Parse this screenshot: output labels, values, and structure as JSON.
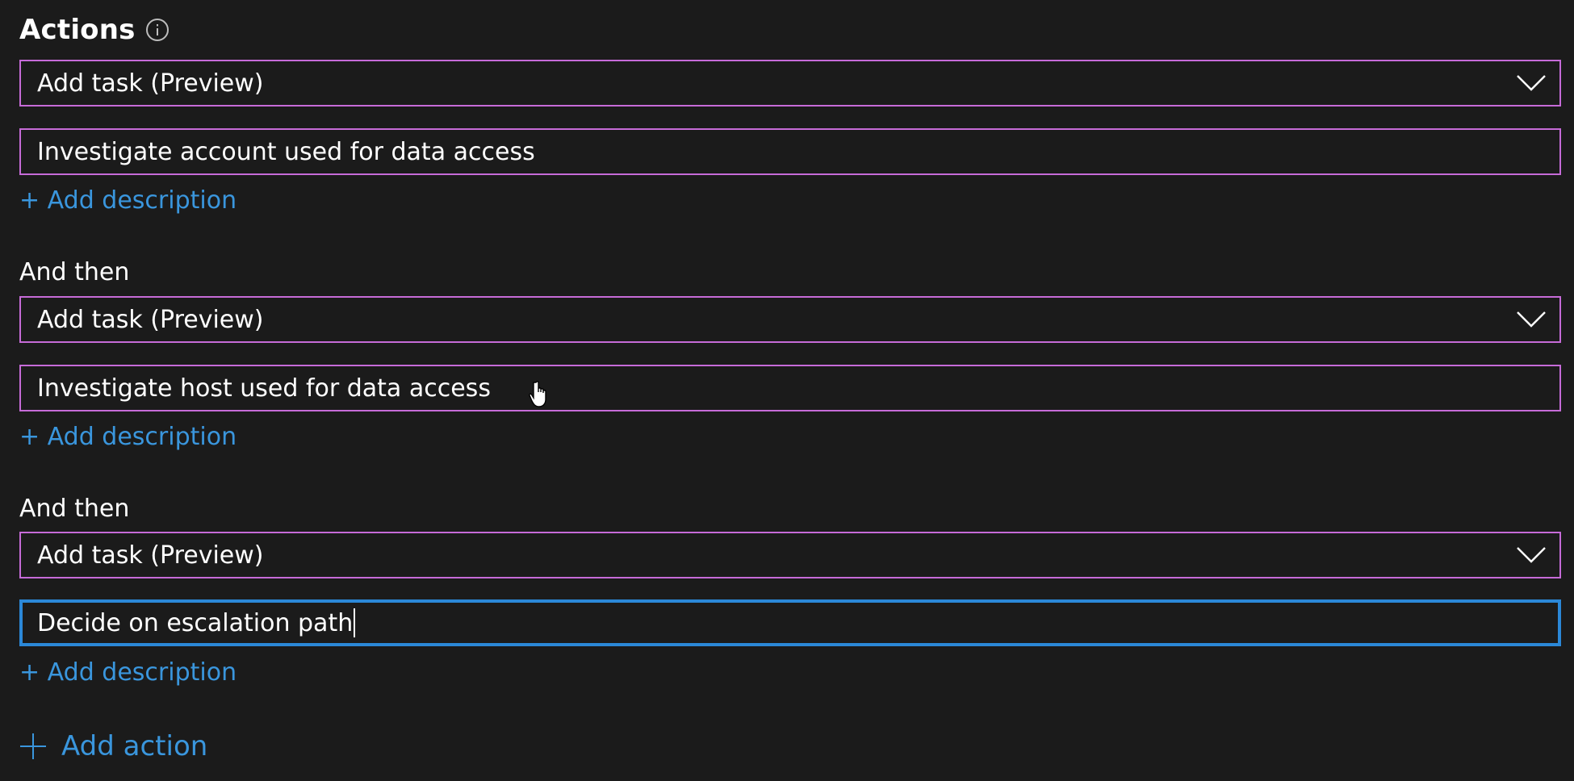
{
  "section": {
    "title": "Actions",
    "info_icon": "info-icon"
  },
  "actions": [
    {
      "type_value": "Add task (Preview)",
      "title_value": "Investigate account used for data access",
      "add_description_label": "+ Add description"
    },
    {
      "prefix_label": "And then",
      "type_value": "Add task (Preview)",
      "title_value": "Investigate host used for data access",
      "add_description_label": "+ Add description"
    },
    {
      "prefix_label": "And then",
      "type_value": "Add task (Preview)",
      "title_value": "Decide on escalation path",
      "add_description_label": "+ Add description"
    }
  ],
  "footer": {
    "add_action_label": "Add action",
    "add_action_icon": "plus-icon"
  },
  "colors": {
    "background": "#1b1b1b",
    "field_border": "#c66bd8",
    "focused_border": "#2b88d8",
    "link": "#3a96dd",
    "text": "#ffffff"
  }
}
